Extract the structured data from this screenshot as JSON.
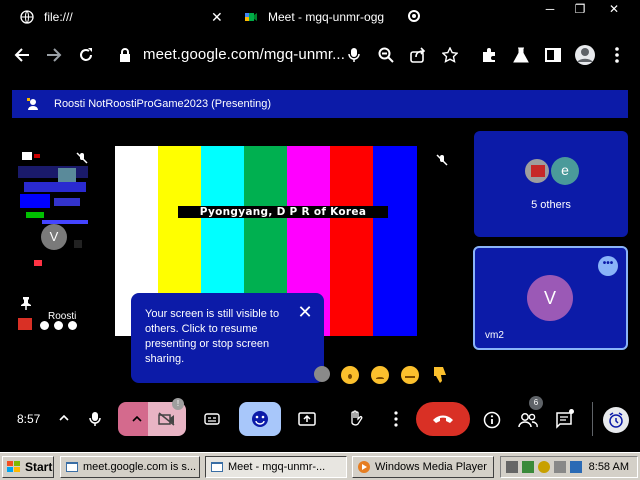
{
  "browser": {
    "tabs": [
      {
        "title": "file:///"
      },
      {
        "title": "Meet - mgq-unmr-ogg"
      }
    ],
    "address": "meet.google.com/mgq-unmr..."
  },
  "meet": {
    "banner": "Roosti NotRoostiProGame2023 (Presenting)",
    "left_tile_name": "Roosti",
    "self_avatar_letter": "V",
    "screen_caption": "Pyongyang, D P R of Korea",
    "others": {
      "label": "5 others",
      "avatar_letter": "e"
    },
    "featured": {
      "name": "vm2",
      "avatar_letter": "V"
    },
    "tooltip": "Your screen is still visible to others. Click to resume presenting or stop screen sharing.",
    "time": "8:57",
    "people_badge": "6",
    "colors": {
      "accent": "#0c1ba8",
      "leave": "#d93025",
      "avatar": "#9b59b6"
    },
    "color_bars": [
      "#ffffff",
      "#ffff00",
      "#00ffff",
      "#00b050",
      "#ff00ff",
      "#ff0000",
      "#0000ff"
    ]
  },
  "taskbar": {
    "start": "Start",
    "tasks": [
      {
        "label": "meet.google.com is s..."
      },
      {
        "label": "Meet - mgq-unmr-..."
      },
      {
        "label": "Windows Media Player"
      }
    ],
    "clock": "8:58 AM"
  }
}
